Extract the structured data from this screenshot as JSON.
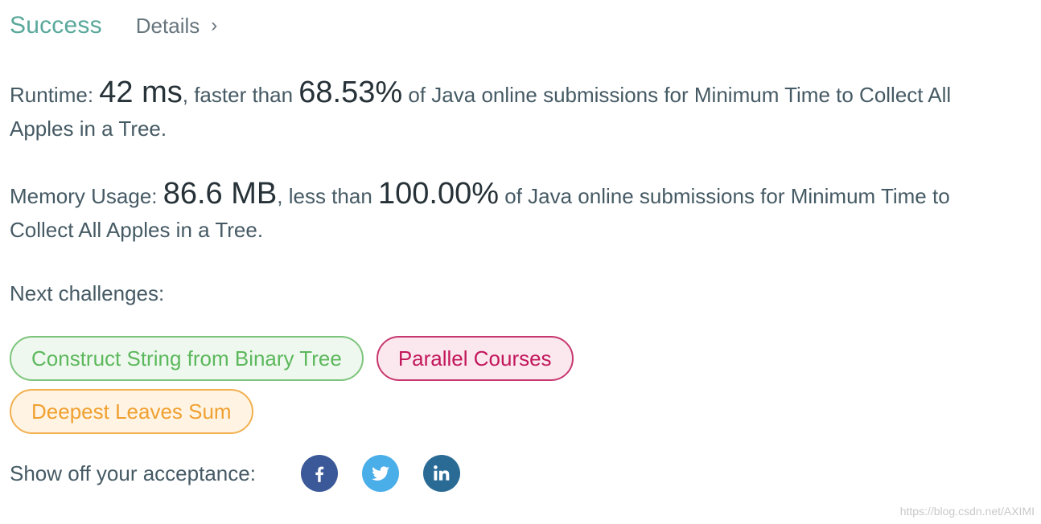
{
  "header": {
    "status": "Success",
    "details_label": "Details",
    "details_chevron": "›"
  },
  "runtime": {
    "label": "Runtime: ",
    "value": "42 ms",
    "comparison": ", faster than ",
    "percentile": "68.53%",
    "tail": " of Java online submissions for Minimum Time to Collect All Apples in a Tree."
  },
  "memory": {
    "label": "Memory Usage: ",
    "value": "86.6 MB",
    "comparison": ", less than ",
    "percentile": "100.00%",
    "tail": " of Java online submissions for Minimum Time to Collect All Apples in a Tree."
  },
  "next": {
    "label": "Next challenges:",
    "challenges": [
      {
        "title": "Construct String from Binary Tree",
        "difficulty": "easy",
        "color": "#5cb85c"
      },
      {
        "title": "Parallel Courses",
        "difficulty": "hard",
        "color": "#c2185b"
      },
      {
        "title": "Deepest Leaves Sum",
        "difficulty": "medium",
        "color": "#f0a030"
      }
    ]
  },
  "share": {
    "label": "Show off your acceptance:",
    "buttons": [
      {
        "icon": "facebook-icon",
        "color": "#3b5998"
      },
      {
        "icon": "twitter-icon",
        "color": "#4aaee8"
      },
      {
        "icon": "linkedin-icon",
        "color": "#2a6b96"
      }
    ]
  },
  "watermark": "https://blog.csdn.net/AXIMI"
}
